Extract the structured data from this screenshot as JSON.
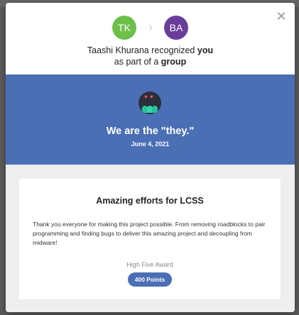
{
  "header": {
    "from_initials": "TK",
    "to_initials": "BA",
    "giver_name": "Taashi Khurana",
    "recognized_text": "recognized",
    "you_text": "you",
    "as_part_of_text": "as part of a",
    "group_text": "group"
  },
  "hero": {
    "title": "We are the \"they.\"",
    "date": "June 4, 2021"
  },
  "card": {
    "title": "Amazing efforts for LCSS",
    "message": "Thank you everyone for making this project possible. From removing roadblocks to pair programming and finding bugs to deliver this amazing project and decoupling from midware!",
    "award_name": "High Five Award",
    "points": "400 Points"
  },
  "colors": {
    "accent_blue": "#4b6fb5",
    "from_avatar": "#6cc04a",
    "to_avatar": "#6a3d9a"
  },
  "icons": [
    "close-icon",
    "chevron-right-icon",
    "team-hearts-icon"
  ]
}
